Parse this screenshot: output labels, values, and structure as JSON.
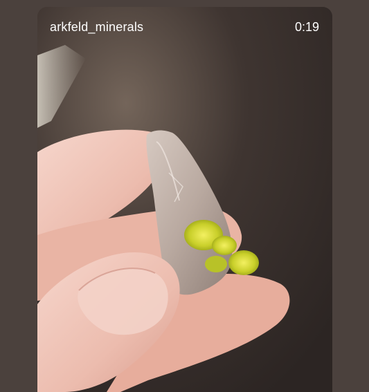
{
  "video": {
    "username": "arkfeld_minerals",
    "timestamp": "0:19"
  },
  "icons": {
    "scene": "photo-of-mineral-specimen"
  }
}
